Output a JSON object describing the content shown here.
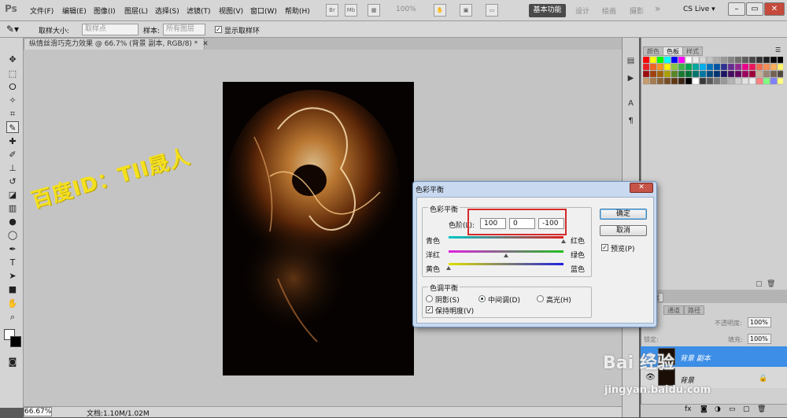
{
  "app": {
    "logo": "Ps"
  },
  "menu": {
    "items": [
      "文件(F)",
      "编辑(E)",
      "图像(I)",
      "图层(L)",
      "选择(S)",
      "滤镜(T)",
      "视图(V)",
      "窗口(W)",
      "帮助(H)"
    ]
  },
  "menubar_right": {
    "zoom": "100%",
    "workspace_active": "基本功能",
    "workspaces": [
      "设计",
      "绘画",
      "摄影"
    ],
    "more": "»",
    "cs_live": "CS Live ▾"
  },
  "options_bar": {
    "sample_size_label": "取样大小:",
    "sample_size_value": "取样点",
    "sample_label": "样本:",
    "sample_value": "所有图层",
    "show_ring_label": "显示取样环",
    "show_ring_checked": true
  },
  "document": {
    "tab_title": "纵情丝滑巧克力效果 @ 66.7% (背景 副本, RGB/8) *",
    "tab_close": "✕"
  },
  "status": {
    "zoom": "66.67%",
    "doc_info": "文档:1.10M/1.02M"
  },
  "watermarks": {
    "text": "百度ID：TII晟人",
    "baidu_logo": "Bai 经验",
    "baidu_url": "jingyan.baidu.com"
  },
  "right_panel": {
    "tabs": [
      "颜色",
      "色板",
      "样式"
    ],
    "active_tab": "色板",
    "layers_tabs": [
      "图层",
      "通道",
      "路径"
    ],
    "opacity_label": "不透明度:",
    "opacity_value": "100%",
    "fill_label": "填充:",
    "fill_value": "100%",
    "lock_label": "锁定:",
    "layers": [
      {
        "name": "背景 副本",
        "selected": true
      },
      {
        "name": "背景",
        "selected": false
      }
    ]
  },
  "swatch_colors": [
    "#ff0000",
    "#ffff00",
    "#00ff00",
    "#00ffff",
    "#0000ff",
    "#ff00ff",
    "#ffffff",
    "#ebebeb",
    "#d6d6d6",
    "#c2c2c2",
    "#adadad",
    "#999999",
    "#858585",
    "#707070",
    "#5c5c5c",
    "#474747",
    "#333333",
    "#1f1f1f",
    "#0a0a0a",
    "#000000",
    "#ed1c24",
    "#f26522",
    "#f7941d",
    "#fff200",
    "#8dc63f",
    "#39b54a",
    "#00a651",
    "#00a99d",
    "#00aeef",
    "#0072bc",
    "#0054a6",
    "#2e3192",
    "#662d91",
    "#92278f",
    "#ec008c",
    "#ed145b",
    "#f26c4f",
    "#f68e56",
    "#fbaf5d",
    "#fff568",
    "#9e0b0f",
    "#a0410d",
    "#a36209",
    "#aba000",
    "#598527",
    "#197b30",
    "#007236",
    "#00746b",
    "#0076a3",
    "#004a80",
    "#003471",
    "#1b1464",
    "#440e62",
    "#630460",
    "#9e005d",
    "#9e0039",
    "#c7b299",
    "#998675",
    "#736357",
    "#534741",
    "#c69c6d",
    "#a67c52",
    "#8c6239",
    "#754c24",
    "#603913",
    "#3c2415",
    "#000000",
    "#ffffff",
    "#3a3a3a",
    "#5a5a5a",
    "#7a7a7a",
    "#9a9a9a",
    "#b4b4b4",
    "#cfcfcf",
    "#e2e2e2",
    "#f0f0f0",
    "#ff8080",
    "#80ff80",
    "#8080ff",
    "#ffff80"
  ],
  "dialog": {
    "title": "色彩平衡",
    "close": "✕",
    "color_balance_group": "色彩平衡",
    "levels_label": "色阶(L):",
    "levels": [
      "100",
      "0",
      "-100"
    ],
    "sliders": [
      {
        "left": "青色",
        "right": "红色",
        "value": 100
      },
      {
        "left": "洋红",
        "right": "绿色",
        "value": 0
      },
      {
        "left": "黄色",
        "right": "蓝色",
        "value": -100
      }
    ],
    "tone_group": "色调平衡",
    "tones": [
      {
        "label": "阴影(S)",
        "selected": false
      },
      {
        "label": "中间调(D)",
        "selected": true
      },
      {
        "label": "高光(H)",
        "selected": false
      }
    ],
    "preserve_luminosity": "保持明度(V)",
    "preserve_checked": true,
    "ok": "确定",
    "cancel": "取消",
    "preview": "预览(P)",
    "preview_checked": true
  }
}
